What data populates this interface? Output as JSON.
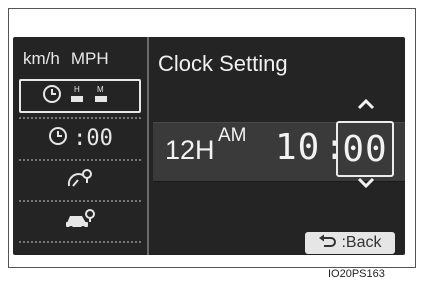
{
  "sidebar": {
    "units_kmh": "km/h",
    "units_mph": "MPH",
    "items": [
      {
        "icon": "clock-date-icon",
        "selected": true
      },
      {
        "icon": "clock-digital-icon",
        "label": ":00"
      },
      {
        "icon": "gauge-settings-icon"
      },
      {
        "icon": "car-settings-icon"
      }
    ]
  },
  "main": {
    "title": "Clock Setting",
    "time_format": "12H",
    "period": "AM",
    "hours": "10",
    "separator": ":",
    "minutes": "00"
  },
  "controls": {
    "up_icon": "chevron-up-icon",
    "down_icon": "chevron-down-icon",
    "back_label": ":Back",
    "back_icon": "return-arrow-icon"
  },
  "caption": "IO20PS163",
  "colors": {
    "screen_bg": "#242424",
    "time_bar_bg": "#3a3a3a",
    "text": "#f2f2f2",
    "button_bg": "#e6e6e6"
  }
}
